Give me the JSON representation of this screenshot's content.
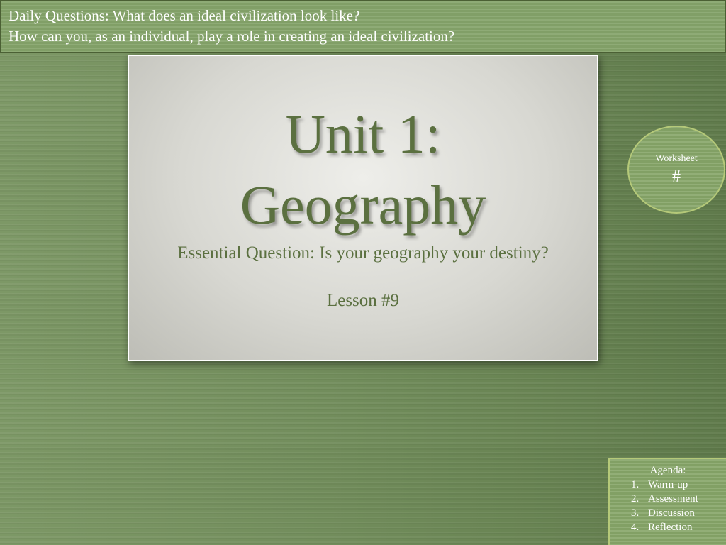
{
  "banner": {
    "line1": "Daily Questions: What does an ideal civilization look like?",
    "line2": "How can you, as an individual, play a role in creating an ideal civilization?"
  },
  "title_card": {
    "title_line1": "Unit 1:",
    "title_line2": "Geography",
    "subtitle": "Essential Question: Is your geography your destiny?",
    "lesson": "Lesson #9"
  },
  "worksheet": {
    "label": "Worksheet",
    "number": "#"
  },
  "agenda": {
    "title": "Agenda:",
    "items": [
      {
        "num": "1.",
        "label": "Warm-up"
      },
      {
        "num": "2.",
        "label": "Assessment"
      },
      {
        "num": "3.",
        "label": "Discussion"
      },
      {
        "num": "4.",
        "label": "Reflection"
      }
    ]
  },
  "colors": {
    "background": "#6f8a58",
    "accent_green": "#86a568",
    "title_text": "#5b7040",
    "card_background": "#d8d8d2"
  }
}
